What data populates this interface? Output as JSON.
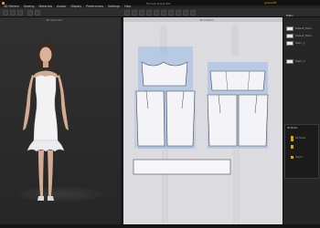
{
  "app": {
    "title": "Female Dress 001",
    "user": "gerberfit"
  },
  "menu": [
    {
      "label": "3D Pattern"
    },
    {
      "label": "Sewing"
    },
    {
      "label": "Materials"
    },
    {
      "label": "Avatar"
    },
    {
      "label": "Display"
    },
    {
      "label": "Preferences"
    },
    {
      "label": "Settings"
    },
    {
      "label": "Help"
    }
  ],
  "view3d": {
    "label": "3D Garment"
  },
  "view2d": {
    "label": "2D Pattern"
  },
  "object_browser": {
    "tab": "Fabric",
    "items": [
      {
        "label": "Default_Fabric"
      },
      {
        "label": "Default_Fabric"
      },
      {
        "label": "Fabric_1"
      },
      {
        "label": "Fabric_2"
      }
    ]
  },
  "property_editor": {
    "title": "3D Model",
    "rows": [
      {
        "label": "3D Model"
      },
      {
        "label": "Object"
      }
    ]
  },
  "colors": {
    "accent": "#e0a300",
    "pattern_fill": "#f4f4f8",
    "pattern_select": "#8cb4e6",
    "dress": "#f2f2f4"
  }
}
